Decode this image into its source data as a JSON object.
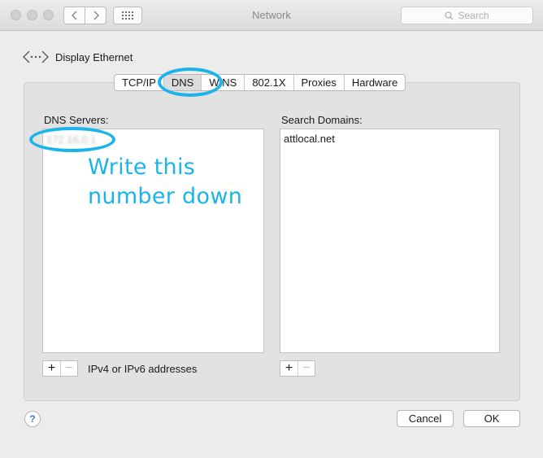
{
  "window": {
    "title": "Network",
    "search_placeholder": "Search"
  },
  "header": {
    "title": "Display Ethernet"
  },
  "tabs": [
    {
      "label": "TCP/IP"
    },
    {
      "label": "DNS"
    },
    {
      "label": "WINS"
    },
    {
      "label": "802.1X"
    },
    {
      "label": "Proxies"
    },
    {
      "label": "Hardware"
    }
  ],
  "dns_servers": {
    "label": "DNS Servers:",
    "items": [
      "172.16.0.1"
    ],
    "hint": "IPv4 or IPv6 addresses"
  },
  "search_domains": {
    "label": "Search Domains:",
    "items": [
      "attlocal.net"
    ]
  },
  "controls": {
    "add": "+",
    "remove": "−"
  },
  "footer": {
    "help": "?",
    "cancel": "Cancel",
    "ok": "OK"
  },
  "annotation": {
    "line1": "Write this",
    "line2": "number down",
    "color": "#1ab4ea"
  }
}
